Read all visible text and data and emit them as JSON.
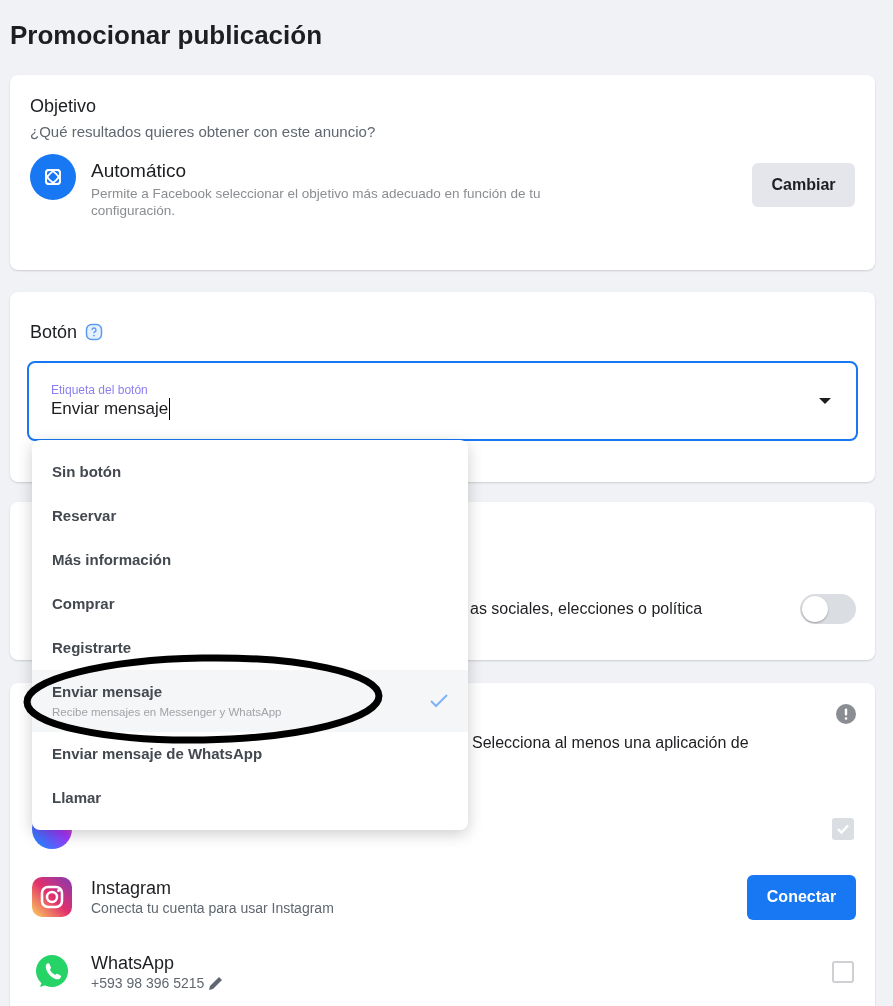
{
  "title": "Promocionar publicación",
  "objective": {
    "heading": "Objetivo",
    "question": "¿Qué resultados quieres obtener con este anuncio?",
    "name": "Automático",
    "description": "Permite a Facebook seleccionar el objetivo más adecuado en función de tu configuración.",
    "button": "Cambiar"
  },
  "button_section": {
    "heading": "Botón",
    "field": {
      "label": "Etiqueta del botón",
      "value": "Enviar mensaje"
    },
    "dropdown": {
      "expanded": true,
      "options": [
        {
          "label": "Sin botón",
          "selected": false
        },
        {
          "label": "Reservar",
          "selected": false
        },
        {
          "label": "Más información",
          "selected": false
        },
        {
          "label": "Comprar",
          "selected": false
        },
        {
          "label": "Registrarte",
          "selected": false
        },
        {
          "label": "Enviar mensaje",
          "sublabel": "Recibe mensajes en Messenger y WhatsApp",
          "selected": true
        },
        {
          "label": "Enviar mensaje de WhatsApp",
          "selected": false
        },
        {
          "label": "Llamar",
          "selected": false
        }
      ]
    }
  },
  "special_category": {
    "text": "as sociales, elecciones o política",
    "on": false
  },
  "apps": {
    "notice": "Selecciona al menos una aplicación de",
    "items": [
      {
        "kind": "messenger",
        "checked": true
      },
      {
        "kind": "instagram",
        "name": "Instagram",
        "description": "Conecta tu cuenta para usar Instagram",
        "action": "Conectar"
      },
      {
        "kind": "whatsapp",
        "name": "WhatsApp",
        "phone": "+593 98 396 5215",
        "checked": false
      }
    ]
  },
  "annotations": [
    {
      "kind": "ellipse"
    }
  ]
}
